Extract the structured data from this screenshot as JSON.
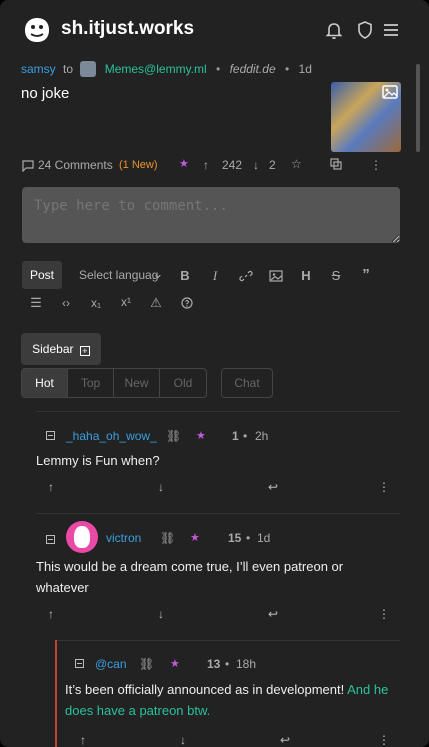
{
  "header": {
    "site_title": "sh.itjust.works",
    "icons": [
      "bell-icon",
      "shield-icon",
      "menu-icon"
    ]
  },
  "post": {
    "author": "samsy",
    "to_label": "to",
    "community": "Memes@lemmy.ml",
    "instance": "feddit.de",
    "age": "1d",
    "title": "no joke",
    "comments_label": "24 Comments",
    "new_label": "(1 New)",
    "upvotes": "242",
    "downvotes": "2"
  },
  "comment_box": {
    "placeholder": "Type here to comment..."
  },
  "toolbar": {
    "post_label": "Post",
    "language_label": "Select languag",
    "buttons": [
      "B",
      "I",
      "H",
      "S",
      "”"
    ],
    "sub_label": "x₁",
    "sup_label": "x¹"
  },
  "sidebar_label": "Sidebar",
  "sort_tabs": [
    "Hot",
    "Top",
    "New",
    "Old"
  ],
  "active_tab": "Hot",
  "chat_label": "Chat",
  "comments": [
    {
      "user": "_haha_oh_wow_",
      "score": "1",
      "age": "2h",
      "text": "Lemmy is Fun when?"
    },
    {
      "user": "victron",
      "score": "15",
      "age": "1d",
      "text": "This would be a dream come true, I’ll even patreon or whatever"
    },
    {
      "user": "@can",
      "score": "13",
      "age": "18h",
      "text_plain": "It’s been officially announced as in development! ",
      "text_link": "And he does have a patreon btw."
    }
  ],
  "colors": {
    "background": "#222222",
    "accent_blue": "#3a9ee0",
    "accent_teal": "#29c29a",
    "new_orange": "#e8932a",
    "thread_rail": "#c23f3a"
  }
}
